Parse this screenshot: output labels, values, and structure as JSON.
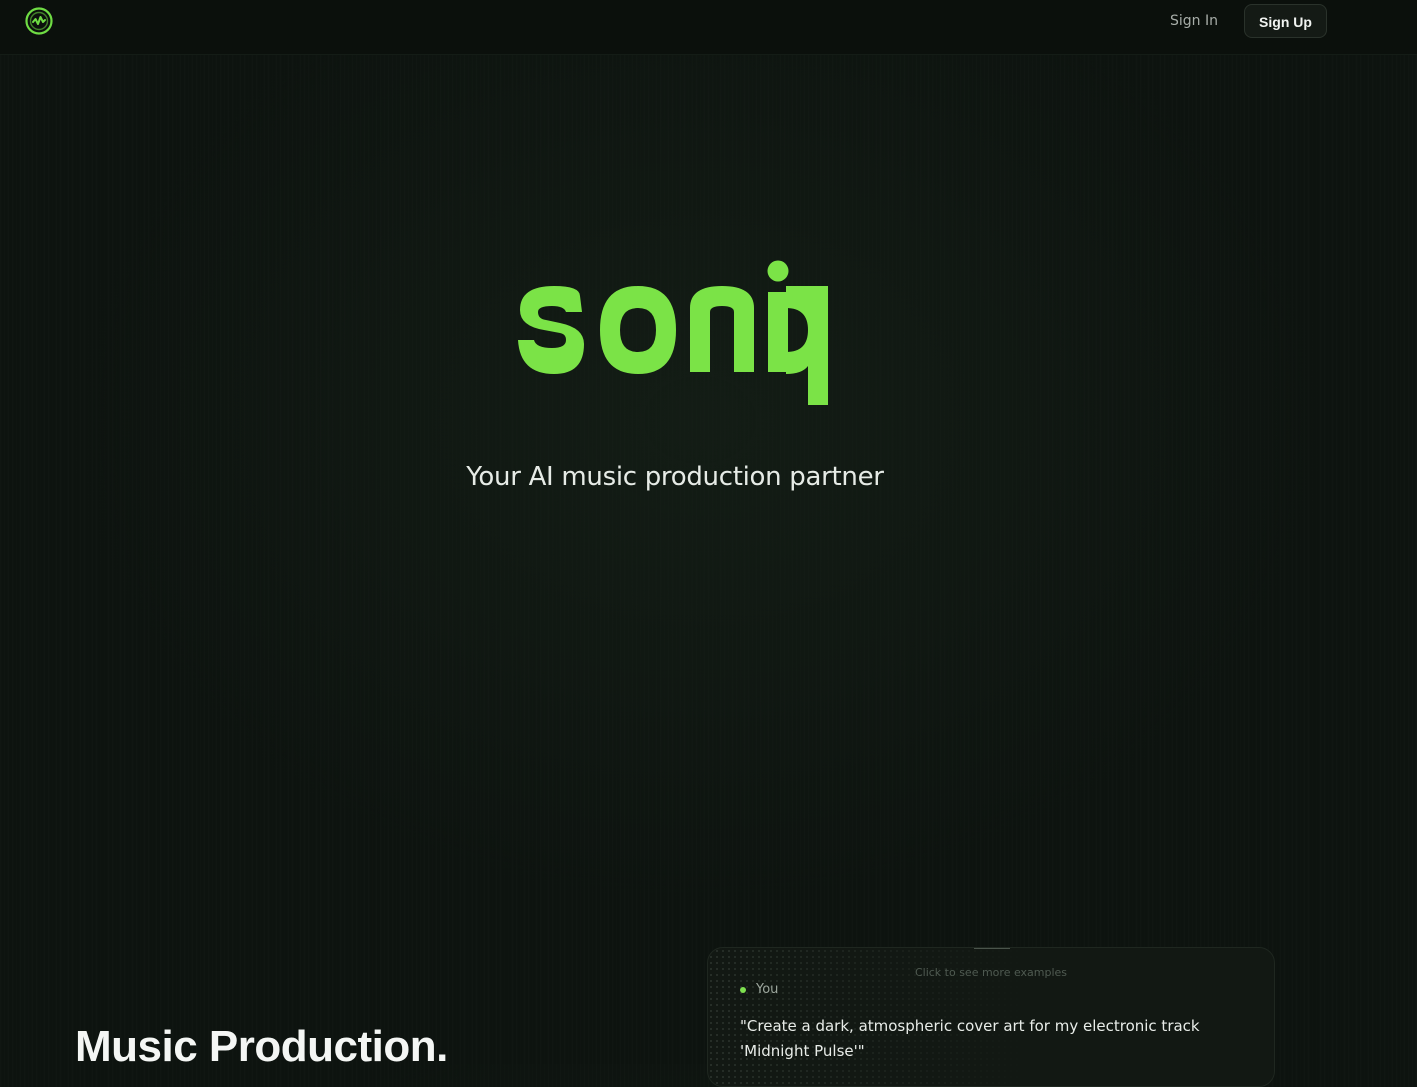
{
  "header": {
    "logo_icon": "waveform-circle-icon",
    "sign_in_label": "Sign In",
    "sign_up_label": "Sign Up"
  },
  "hero": {
    "wordmark": "soniq",
    "tagline": "Your AI music production partner"
  },
  "features": {
    "section_title": "Music Production."
  },
  "demo": {
    "hint": "Click to see more examples",
    "speaker": "You",
    "prompt": "\"Create a dark, atmospheric cover art for my electronic track 'Midnight Pulse'\""
  },
  "colors": {
    "accent": "#7ee04f",
    "background": "#0d130f",
    "text": "#e9eee9"
  }
}
